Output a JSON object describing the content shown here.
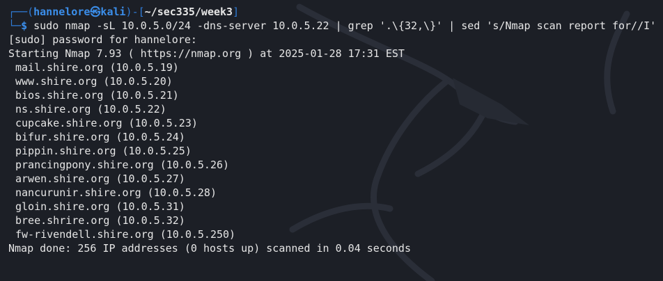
{
  "prompt": {
    "user": "hannelore",
    "skull": "㉿",
    "host": "kali",
    "path": "~/sec335/week3"
  },
  "command": "sudo nmap -sL 10.0.5.0/24 -dns-server 10.0.5.22 | grep '.\\{32,\\}' | sed 's/Nmap scan report for//I'",
  "output": {
    "sudo_prompt": "[sudo] password for hannelore:",
    "start_line": "Starting Nmap 7.93 ( https://nmap.org ) at 2025-01-28 17:31 EST",
    "hosts": [
      "mail.shire.org (10.0.5.19)",
      "www.shire.org (10.0.5.20)",
      "bios.shire.org (10.0.5.21)",
      "ns.shire.org (10.0.5.22)",
      "cupcake.shire.org (10.0.5.23)",
      "bifur.shire.org (10.0.5.24)",
      "pippin.shire.org (10.0.5.25)",
      "prancingpony.shire.org (10.0.5.26)",
      "arwen.shire.org (10.0.5.27)",
      "nancurunir.shire.org (10.0.5.28)",
      "gloin.shire.org (10.0.5.31)",
      "bree.shrire.org (10.0.5.32)",
      "fw-rivendell.shire.org (10.0.5.250)"
    ],
    "done_line": "Nmap done: 256 IP addresses (0 hosts up) scanned in 0.04 seconds"
  },
  "colors": {
    "background": "#1c1f26",
    "prompt_blue": "#3b8eea",
    "text": "#e6e6e6"
  }
}
